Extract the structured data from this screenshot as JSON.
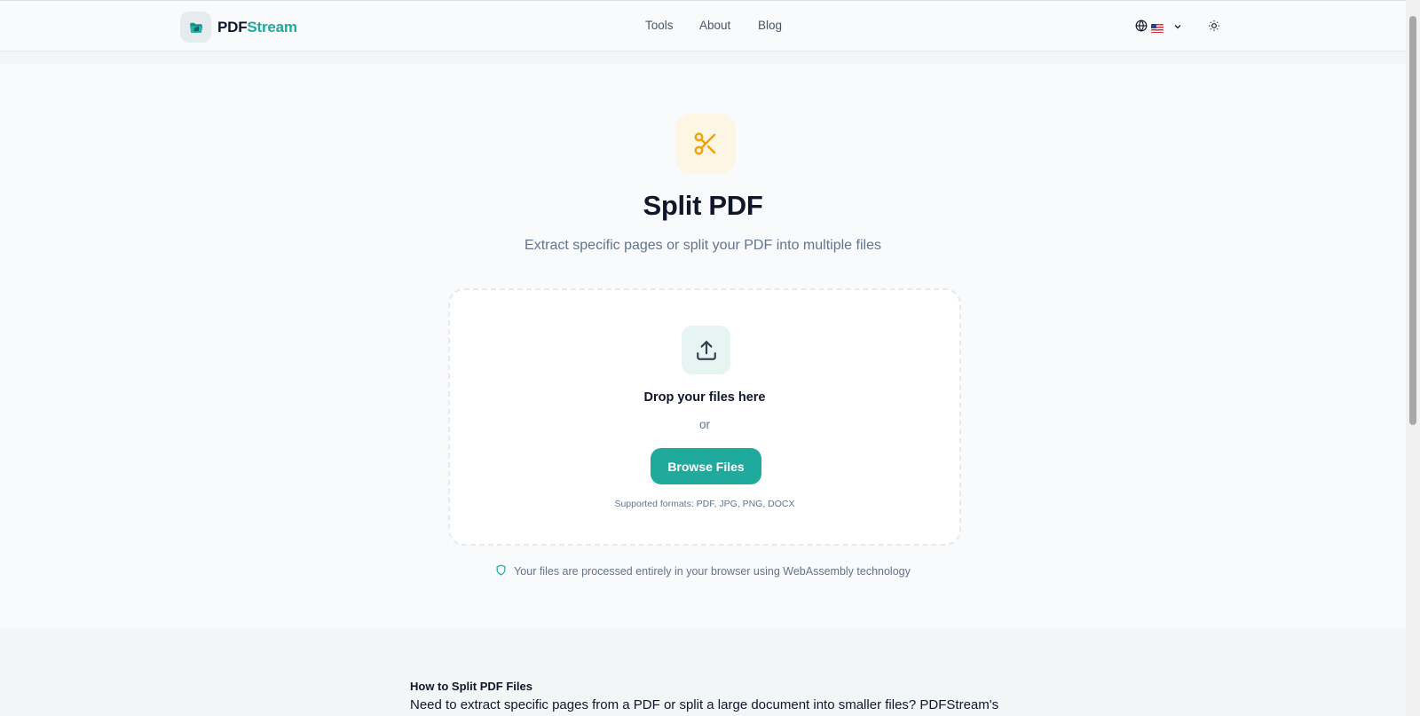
{
  "header": {
    "logo": {
      "part1": "PDF",
      "part2": "Stream",
      "icon": "folder-logo-icon"
    },
    "nav": {
      "tools": "Tools",
      "about": "About",
      "blog": "Blog"
    },
    "language": {
      "icon": "globe-icon",
      "flag": "us-flag-icon",
      "chevron": "chevron-down-icon"
    },
    "theme_toggle_icon": "sun-icon"
  },
  "hero": {
    "icon": "scissors-icon",
    "title": "Split PDF",
    "subtitle": "Extract specific pages or split your PDF into multiple files"
  },
  "dropzone": {
    "icon": "upload-icon",
    "drop_text": "Drop your files here",
    "or_text": "or",
    "browse_label": "Browse Files",
    "formats": "Supported formats: PDF, JPG, PNG, DOCX"
  },
  "privacy": {
    "icon": "shield-icon",
    "text": "Your files are processed entirely in your browser using WebAssembly technology"
  },
  "howto": {
    "title": "How to Split PDF Files",
    "body": "Need to extract specific pages from a PDF or split a large document into smaller files? PDFStream's"
  },
  "colors": {
    "accent": "#20a99d",
    "scissors": "#f0a30a",
    "text_dark": "#0f172a",
    "text_muted": "#64748b"
  }
}
